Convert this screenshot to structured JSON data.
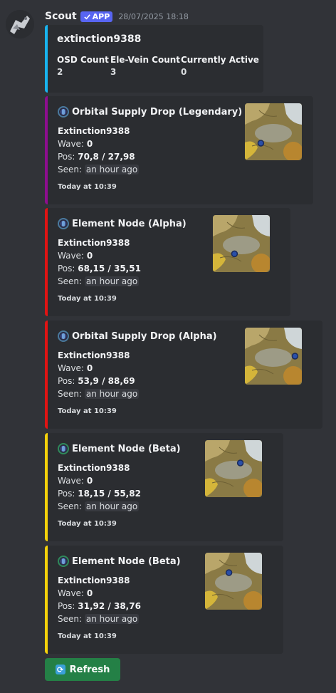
{
  "message": {
    "author": "Scout",
    "badge": "APP",
    "timestamp": "28/07/2025 18:18"
  },
  "summary": {
    "title": "extinction9388",
    "fields": [
      {
        "name": "OSD Count",
        "value": "2"
      },
      {
        "name": "Ele-Vein Count",
        "value": "3"
      },
      {
        "name": "Currently Active",
        "value": "0"
      }
    ]
  },
  "labels": {
    "wave": "Wave:",
    "pos": "Pos:",
    "seen": "Seen:"
  },
  "cards": [
    {
      "title": "Orbital Supply Drop (Legendary)",
      "owner": "Extinction9388",
      "wave": "0",
      "pos": "70,8 / 27,98",
      "seen": "an hour ago",
      "footer": "Today at 10:39",
      "accent": "#8e0e8f",
      "icon": "supply-drop-icon"
    },
    {
      "title": "Element Node (Alpha)",
      "owner": "Extinction9388",
      "wave": "0",
      "pos": "68,15 / 35,51",
      "seen": "an hour ago",
      "footer": "Today at 10:39",
      "accent": "#e01414",
      "icon": "element-node-icon"
    },
    {
      "title": "Orbital Supply Drop (Alpha)",
      "owner": "Extinction9388",
      "wave": "0",
      "pos": "53,9 / 88,69",
      "seen": "an hour ago",
      "footer": "Today at 10:39",
      "accent": "#e01414",
      "icon": "supply-drop-icon"
    },
    {
      "title": "Element Node (Beta)",
      "owner": "Extinction9388",
      "wave": "0",
      "pos": "18,15 / 55,82",
      "seen": "an hour ago",
      "footer": "Today at 10:39",
      "accent": "#f5d20a",
      "icon": "element-node-icon"
    },
    {
      "title": "Element Node (Beta)",
      "owner": "Extinction9388",
      "wave": "0",
      "pos": "31,92 / 38,76",
      "seen": "an hour ago",
      "footer": "Today at 10:39",
      "accent": "#f5d20a",
      "icon": "element-node-icon"
    }
  ],
  "refresh": {
    "label": "Refresh",
    "color": "#248046"
  }
}
